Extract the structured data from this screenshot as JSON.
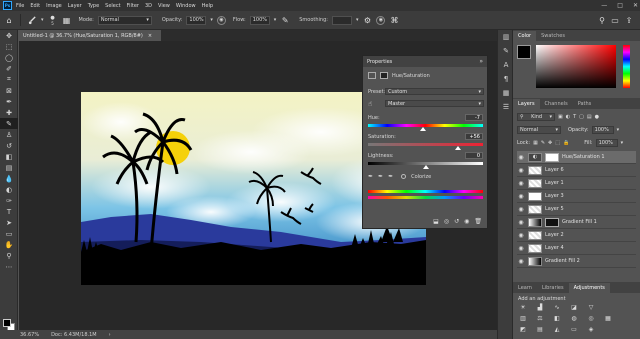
{
  "app": {
    "logo_text": "Ps",
    "menu": [
      "File",
      "Edit",
      "Image",
      "Layer",
      "Type",
      "Select",
      "Filter",
      "3D",
      "View",
      "Window",
      "Help"
    ],
    "window_controls": [
      "—",
      "□",
      "✕"
    ]
  },
  "options_bar": {
    "mode_label": "Mode:",
    "mode_value": "Normal",
    "opacity_label": "Opacity:",
    "opacity_value": "100%",
    "flow_label": "Flow:",
    "flow_value": "100%",
    "smoothing_label": "Smoothing:",
    "brush_size": "5"
  },
  "document": {
    "tab_title": "Untitled-1 @ 36.7% (Hue/Saturation 1, RGB/8#)",
    "close_symbol": "×"
  },
  "status_bar": {
    "zoom": "36.67%",
    "doc_info": "Doc: 6.43M/18.1M"
  },
  "properties": {
    "title": "Properties",
    "collapse_symbol": "»",
    "adjustment_name": "Hue/Saturation",
    "preset_label": "Preset:",
    "preset_value": "Custom",
    "channel_value": "Master",
    "hue_label": "Hue:",
    "hue_value": "-7",
    "hue_fraction": 0.48,
    "saturation_label": "Saturation:",
    "saturation_value": "+56",
    "saturation_fraction": 0.78,
    "lightness_label": "Lightness:",
    "lightness_value": "0",
    "lightness_fraction": 0.5,
    "colorize_label": "Colorize"
  },
  "color_panel": {
    "tabs": [
      "Color",
      "Swatches"
    ]
  },
  "layers_panel": {
    "tabs": [
      "Layers",
      "Channels",
      "Paths"
    ],
    "kind_label": "Kind",
    "blend_mode": "Normal",
    "opacity_label": "Opacity:",
    "opacity_value": "100%",
    "lock_label": "Lock:",
    "fill_label": "Fill:",
    "fill_value": "100%",
    "layers": [
      {
        "name": "Hue/Saturation 1",
        "type": "adjustment",
        "selected": true
      },
      {
        "name": "Layer 6",
        "type": "pixel"
      },
      {
        "name": "Layer 1",
        "type": "pixel"
      },
      {
        "name": "Layer 3",
        "type": "pixel"
      },
      {
        "name": "Layer 5",
        "type": "pixel"
      },
      {
        "name": "Gradient Fill 1",
        "type": "fill"
      },
      {
        "name": "Layer 2",
        "type": "pixel"
      },
      {
        "name": "Layer 4",
        "type": "pixel"
      },
      {
        "name": "Gradient Fill 2",
        "type": "fill"
      }
    ]
  },
  "adjustments_panel": {
    "tabs": [
      "Learn",
      "Libraries",
      "Adjustments"
    ],
    "hint": "Add an adjustment"
  }
}
